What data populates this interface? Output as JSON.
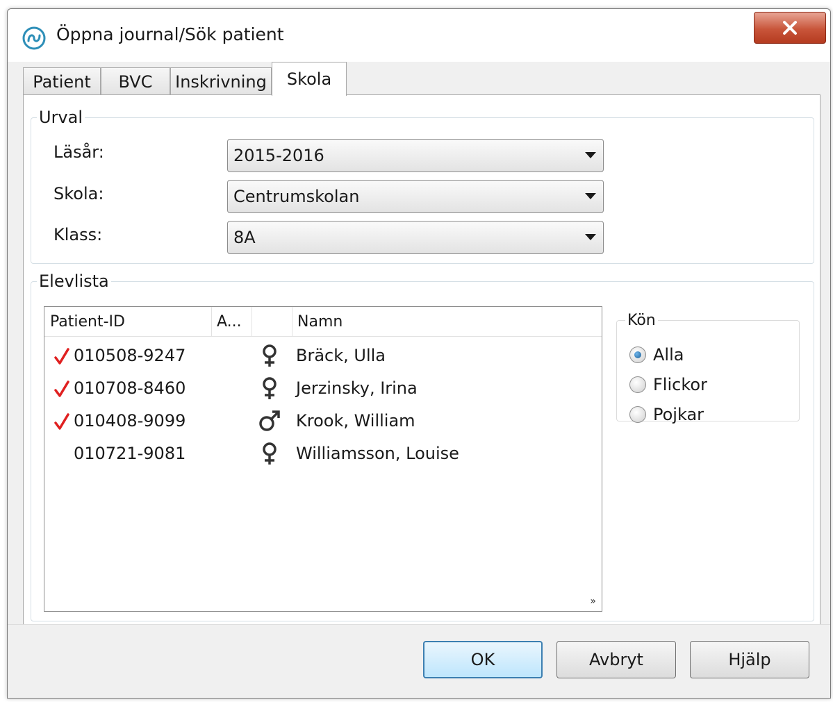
{
  "window": {
    "title": "Öppna journal/Sök patient",
    "close_icon": "close-icon",
    "app_icon": "app-logo-icon"
  },
  "tabs": [
    {
      "label": "Patient"
    },
    {
      "label": "BVC"
    },
    {
      "label": "Inskrivning"
    },
    {
      "label": "Skola",
      "active": true
    }
  ],
  "urval": {
    "legend": "Urval",
    "lasar": {
      "label": "Läsår:",
      "value": "2015-2016"
    },
    "skola": {
      "label": "Skola:",
      "value": "Centrumskolan"
    },
    "klass": {
      "label": "Klass:",
      "value": "8A"
    }
  },
  "elevlista": {
    "legend": "Elevlista",
    "columns": [
      "Patient-ID",
      "A...",
      "",
      "Namn"
    ],
    "rows": [
      {
        "checked": true,
        "patient_id": "010508-9247",
        "sex": "female",
        "sex_icon": "female-icon",
        "name": "Bräck, Ulla"
      },
      {
        "checked": true,
        "patient_id": "010708-8460",
        "sex": "female",
        "sex_icon": "female-icon",
        "name": "Jerzinsky, Irina"
      },
      {
        "checked": true,
        "patient_id": "010408-9099",
        "sex": "male",
        "sex_icon": "male-icon",
        "name": "Krook, William"
      },
      {
        "checked": false,
        "patient_id": "010721-9081",
        "sex": "female",
        "sex_icon": "female-icon",
        "name": "Williamsson, Louise"
      }
    ],
    "check_color": "#e02020",
    "grip_glyph": "»"
  },
  "kon": {
    "legend": "Kön",
    "options": [
      {
        "label": "Alla",
        "selected": true
      },
      {
        "label": "Flickor",
        "selected": false
      },
      {
        "label": "Pojkar",
        "selected": false
      }
    ]
  },
  "buttons": {
    "ok": "OK",
    "cancel": "Avbryt",
    "help": "Hjälp"
  }
}
